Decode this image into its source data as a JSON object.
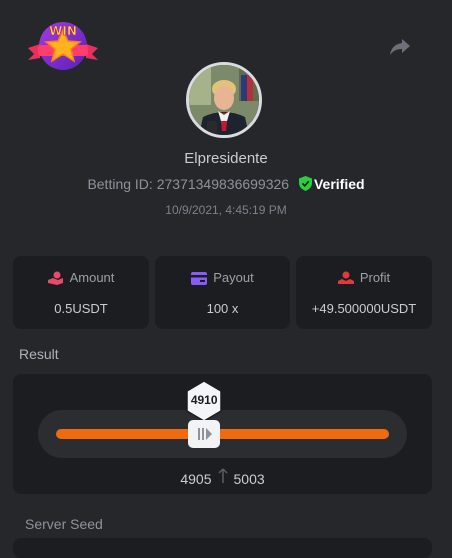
{
  "header": {
    "badge_icon": "win-star-badge",
    "badge_text": "WIN",
    "share_icon": "share-arrow-icon"
  },
  "user": {
    "avatar_icon": "user-avatar",
    "username": "Elpresidente",
    "betting_id_label": "Betting ID:",
    "betting_id": "27371349836699326",
    "verified_label": "Verified",
    "timestamp": "10/9/2021, 4:45:19 PM"
  },
  "stats": {
    "amount": {
      "label": "Amount",
      "value": "0.5USDT",
      "icon": "coins-hand-icon"
    },
    "payout": {
      "label": "Payout",
      "value": "100 x",
      "icon": "wallet-card-icon"
    },
    "profit": {
      "label": "Profit",
      "value": "+49.500000USDT",
      "icon": "money-hand-icon"
    }
  },
  "result": {
    "label": "Result",
    "value": "4910",
    "range_low": "4905",
    "range_high": "5003",
    "slider_position": 0.445,
    "fill_color": "#f06a0f"
  },
  "server_seed": {
    "label": "Server Seed"
  },
  "colors": {
    "background": "#25272b",
    "card": "#1c1d21",
    "verified_shield": "#2ecc40",
    "amount_icon": "#e84a6a",
    "payout_icon": "#8a5cf6",
    "profit_icon": "#e03b3b"
  }
}
